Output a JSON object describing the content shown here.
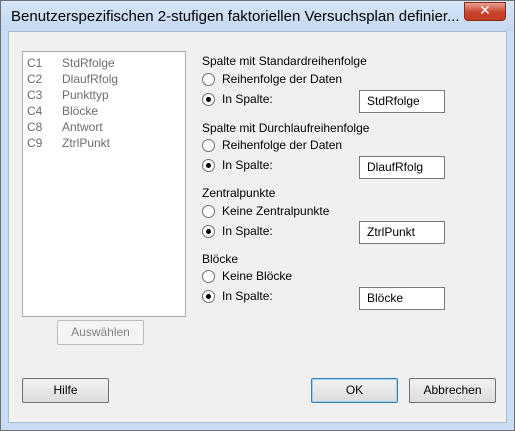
{
  "window": {
    "title": "Benutzerspezifischen 2-stufigen faktoriellen Versuchsplan definier...",
    "close_glyph": "✕"
  },
  "columns": [
    {
      "id": "C1",
      "name": "StdRfolge"
    },
    {
      "id": "C2",
      "name": "DlaufRfolg"
    },
    {
      "id": "C3",
      "name": "Punkttyp"
    },
    {
      "id": "C4",
      "name": "Blöcke"
    },
    {
      "id": "C8",
      "name": "Antwort"
    },
    {
      "id": "C9",
      "name": "ZtrlPunkt"
    }
  ],
  "select_button": "Auswählen",
  "groups": {
    "std": {
      "title": "Spalte mit Standardreihenfolge",
      "option1": "Reihenfolge der Daten",
      "option2": "In Spalte:",
      "value": "StdRfolge"
    },
    "run": {
      "title": "Spalte mit Durchlaufreihenfolge",
      "option1": "Reihenfolge der Daten",
      "option2": "In Spalte:",
      "value": "DlaufRfolg"
    },
    "center": {
      "title": "Zentralpunkte",
      "option1": "Keine Zentralpunkte",
      "option2": "In Spalte:",
      "value": "ZtrlPunkt"
    },
    "blocks": {
      "title": "Blöcke",
      "option1": "Keine Blöcke",
      "option2": "In Spalte:",
      "value": "Blöcke"
    }
  },
  "buttons": {
    "help": "Hilfe",
    "ok": "OK",
    "cancel": "Abbrechen"
  }
}
